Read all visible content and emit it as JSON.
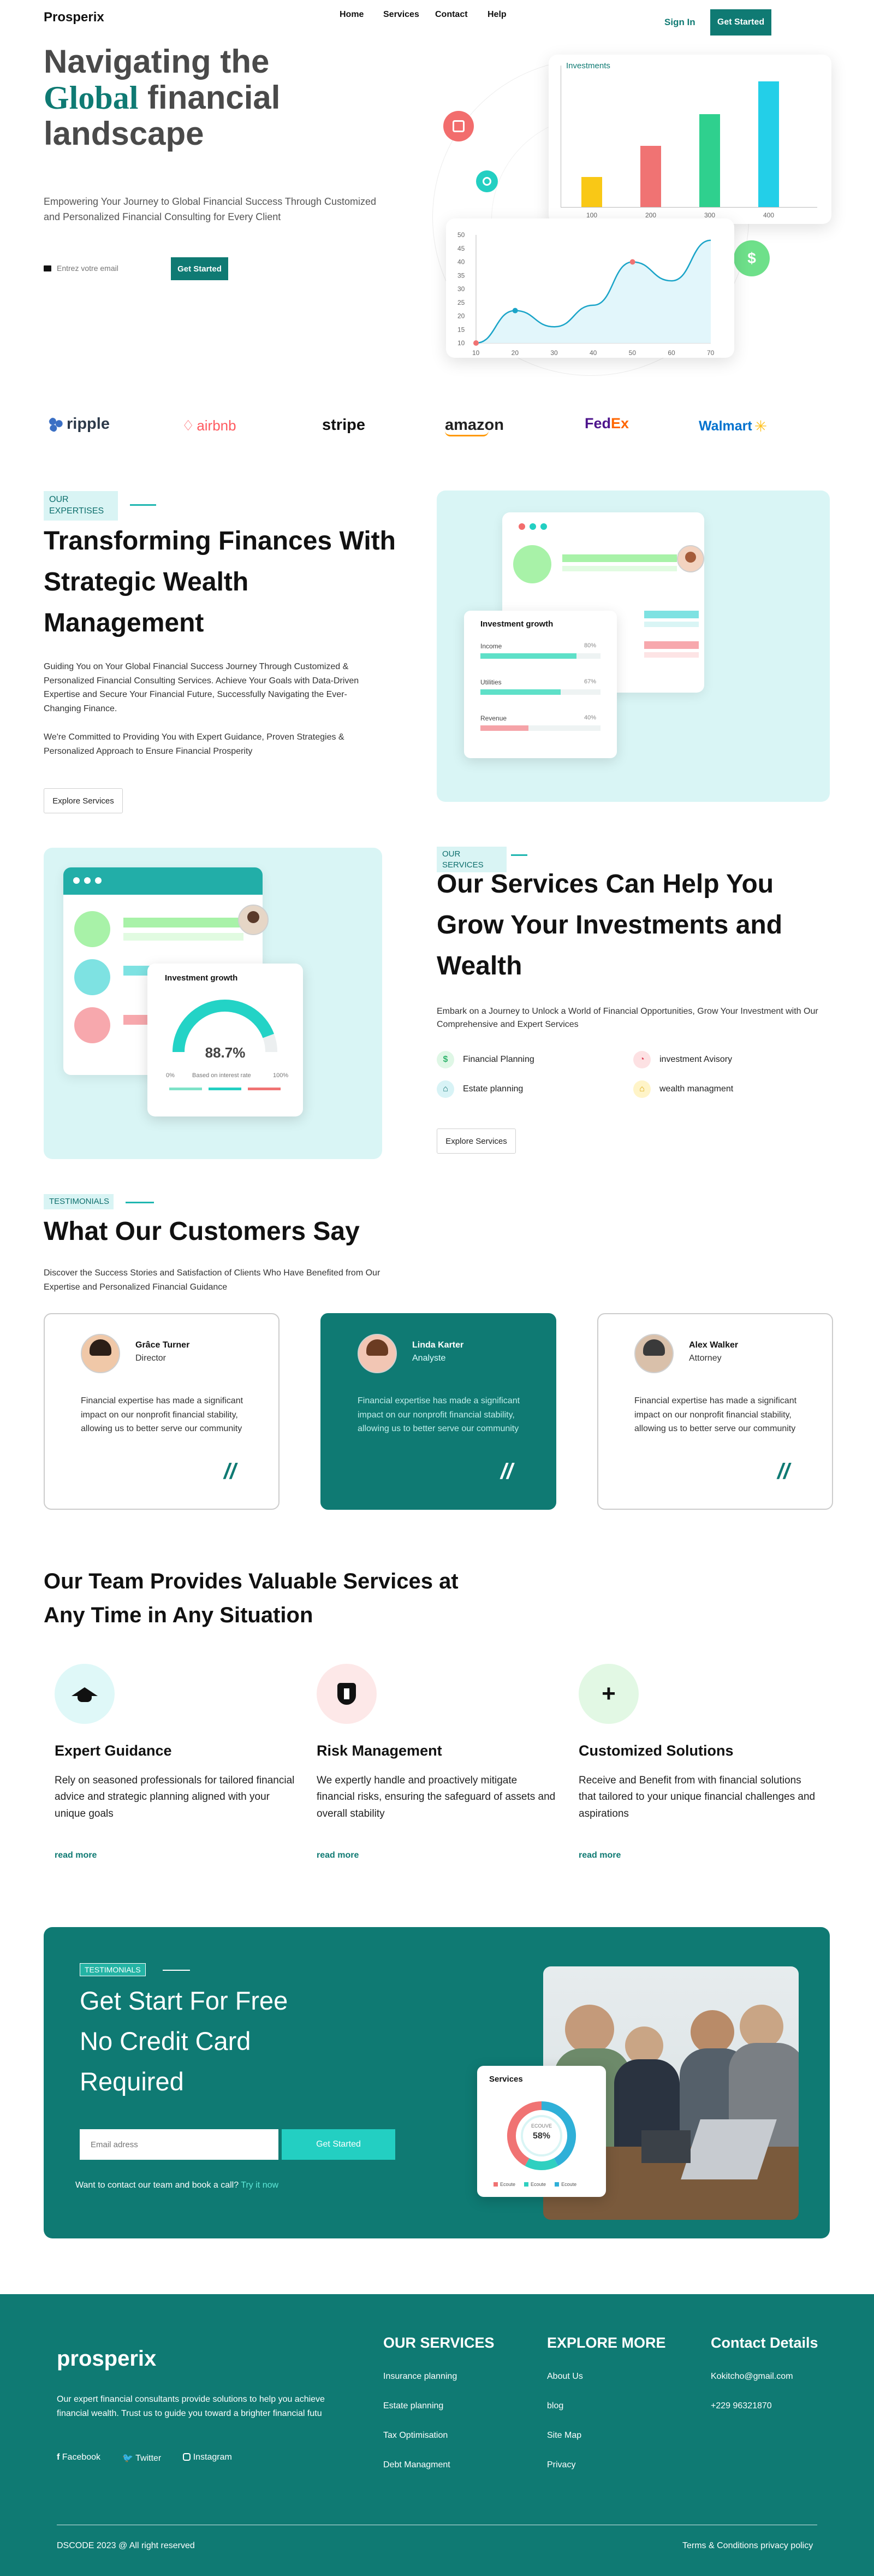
{
  "brand": "Prosperix",
  "nav": {
    "home": "Home",
    "services": "Services",
    "contact": "Contact",
    "help": "Help",
    "signin": "Sign In",
    "get_started": "Get Started"
  },
  "hero": {
    "title_line1": "Navigating the",
    "title_global": "Global",
    "title_line2_rest": " financial",
    "title_line3": "landscape",
    "subtitle": "Empowering Your Journey to Global Financial Success Through Customized and Personalized Financial Consulting for Every Client",
    "email_placeholder": "Entrez votre email",
    "cta": "Get Started"
  },
  "hero_bar_card": {
    "title": "Investments",
    "categories": [
      "100",
      "200",
      "300",
      "400"
    ],
    "values": [
      22,
      45,
      68,
      92
    ],
    "colors": [
      "#f9c816",
      "#f07373",
      "#2fd08e",
      "#23cfe8"
    ]
  },
  "hero_line_card": {
    "x": [
      "10",
      "20",
      "30",
      "40",
      "50",
      "60",
      "70"
    ],
    "y_ticks": [
      "50",
      "45",
      "40",
      "35",
      "30",
      "25",
      "20",
      "15",
      "10"
    ],
    "points": [
      [
        10,
        10
      ],
      [
        20,
        22
      ],
      [
        30,
        16
      ],
      [
        40,
        24
      ],
      [
        50,
        40
      ],
      [
        60,
        33
      ],
      [
        70,
        48
      ]
    ]
  },
  "brands": [
    "ripple",
    "airbnb",
    "stripe",
    "amazon",
    "FedEx",
    "Walmart"
  ],
  "expertise": {
    "tag": "OUR EXPERTISES",
    "title": "Transforming Finances With Strategic Wealth Management",
    "p1": "Guiding You on Your Global Financial Success Journey Through Customized & Personalized Financial Consulting Services. Achieve Your Goals with Data-Driven Expertise and Secure Your Financial Future, Successfully Navigating the Ever-Changing Finance.",
    "p2": "We're Committed to Providing You with Expert Guidance, Proven Strategies & Personalized Approach to Ensure Financial Prosperity",
    "button": "Explore Services",
    "growth_card": {
      "title": "Investment growth",
      "rows": [
        {
          "label": "Income",
          "pct": "80%",
          "value": 80,
          "color": "#5ee0c8"
        },
        {
          "label": "Utilities",
          "pct": "67%",
          "value": 67,
          "color": "#5ee0c8"
        },
        {
          "label": "Revenue",
          "pct": "40%",
          "value": 40,
          "color": "#f5a3a8"
        }
      ]
    }
  },
  "services_section": {
    "tag": "OUR SERVICES",
    "title": "Our Services Can Help You Grow Your Investments and Wealth",
    "desc": "Embark on a Journey to Unlock a World of Financial Opportunities, Grow Your Investment with Our Comprehensive and Expert Services",
    "items": [
      {
        "label": "Financial Planning",
        "icon": "dollar-icon",
        "color": "#dff7e6",
        "icon_color": "#2fb36c"
      },
      {
        "label": "investment Avisory",
        "icon": "chart-icon",
        "color": "#fde1e3",
        "icon_color": "#e0435a"
      },
      {
        "label": "Estate planning",
        "icon": "home-icon",
        "color": "#d8f3f6",
        "icon_color": "#0e6f6d"
      },
      {
        "label": "wealth managment",
        "icon": "home-icon",
        "color": "#fff4c8",
        "icon_color": "#d9a300"
      }
    ],
    "button": "Explore Services",
    "gauge_card": {
      "title": "Investment growth",
      "value": "88.7%",
      "min": "0%",
      "caption": "Based on interest rate",
      "max": "100%",
      "fraction": 0.887
    }
  },
  "testimonials": {
    "tag": "TESTIMONIALS",
    "title": "What Our Customers Say",
    "desc": "Discover the Success Stories and Satisfaction of Clients Who Have Benefited from Our Expertise and Personalized Financial Guidance",
    "items": [
      {
        "name": "Grâce Turner",
        "role": "Director",
        "text": "Financial expertise has made a significant impact on our nonprofit financial stability, allowing us to better serve our community"
      },
      {
        "name": "Linda Karter",
        "role": "Analyste",
        "text": "Financial expertise has made a significant impact on our nonprofit financial stability, allowing us to better serve our community"
      },
      {
        "name": "Alex Walker",
        "role": "Attorney",
        "text": "Financial expertise has made a significant impact on our nonprofit financial stability, allowing us to better serve our community"
      }
    ],
    "quote_mark": "//"
  },
  "team": {
    "title": "Our Team Provides Valuable Services at Any Time in Any Situation",
    "items": [
      {
        "title": "Expert Guidance",
        "desc": "Rely on seasoned professionals for tailored financial advice and strategic planning aligned with your unique goals",
        "link": "read more",
        "icon": "graduation-cap-icon",
        "bg": "#dff8f8"
      },
      {
        "title": "Risk Management",
        "desc": "We expertly handle and proactively mitigate financial risks, ensuring the safeguard of assets and overall stability",
        "link": "read more",
        "icon": "shield-icon",
        "bg": "#fde8e8"
      },
      {
        "title": "Customized Solutions",
        "desc": "Receive and Benefit from with financial solutions that tailored to your unique financial challenges and aspirations",
        "link": "read more",
        "icon": "plus-icon",
        "bg": "#e2f8e4"
      }
    ]
  },
  "cta": {
    "tag": "TESTIMONIALS",
    "title_l1": "Get Start For Free",
    "title_l2": "No Credit Card",
    "title_l3": "Required",
    "email_placeholder": "Email adress",
    "button": "Get Started",
    "call_text": "Want to contact our team and book a call?",
    "call_link": "Try it now",
    "donut_card": {
      "title": "Services",
      "center_label": "ECOUVE",
      "center_value": "58%",
      "legend": [
        "Ecoute",
        "Ecoute",
        "Ecoute"
      ],
      "legend_colors": [
        "#f07373",
        "#2fd0c0",
        "#2fb0d8"
      ]
    }
  },
  "footer": {
    "brand": "prosperix",
    "desc": "Our expert financial consultants provide solutions to help you achieve financial wealth. Trust us to guide you toward a brighter financial futu",
    "socials": [
      "Facebook",
      "Twitter",
      "Instagram"
    ],
    "col1_title": "OUR SERVICES",
    "col1": [
      "Insurance planning",
      "Estate planning",
      "Tax Optimisation",
      "Debt Managment"
    ],
    "col2_title": "EXPLORE MORE",
    "col2": [
      "About Us",
      "blog",
      "Site Map",
      "Privacy"
    ],
    "col3_title": "Contact Details",
    "col3": [
      "Kokitcho@gmail.com",
      "+229 96321870"
    ],
    "copyright": "DSCODE 2023 @ All right reserved",
    "legal": "Terms & Conditions privacy policy"
  }
}
